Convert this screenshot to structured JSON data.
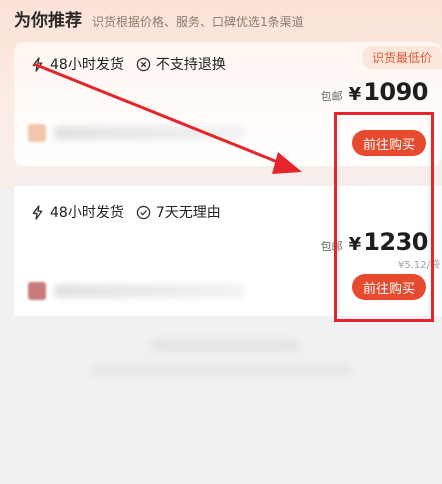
{
  "header": {
    "title": "为你推荐",
    "subtitle": "识货根据价格、服务、口碑优选1条渠道"
  },
  "offers": [
    {
      "badge": "识货最低价",
      "tags": [
        {
          "icon": "lightning-icon",
          "label": "48小时发货"
        },
        {
          "icon": "no-return-icon",
          "label": "不支持退换"
        }
      ],
      "shipping": "包邮",
      "currency": "¥",
      "price": "1090",
      "button": "前往购买"
    },
    {
      "tags": [
        {
          "icon": "lightning-icon",
          "label": "48小时发货"
        },
        {
          "icon": "check-circle-icon",
          "label": "7天无理由"
        }
      ],
      "shipping": "包邮",
      "currency": "¥",
      "price": "1230",
      "unit_price": "¥5.12/袋",
      "button": "前往购买"
    }
  ],
  "colors": {
    "accent": "#e84a2e",
    "annotation": "#e5242b",
    "badge_text": "#e0562f"
  }
}
